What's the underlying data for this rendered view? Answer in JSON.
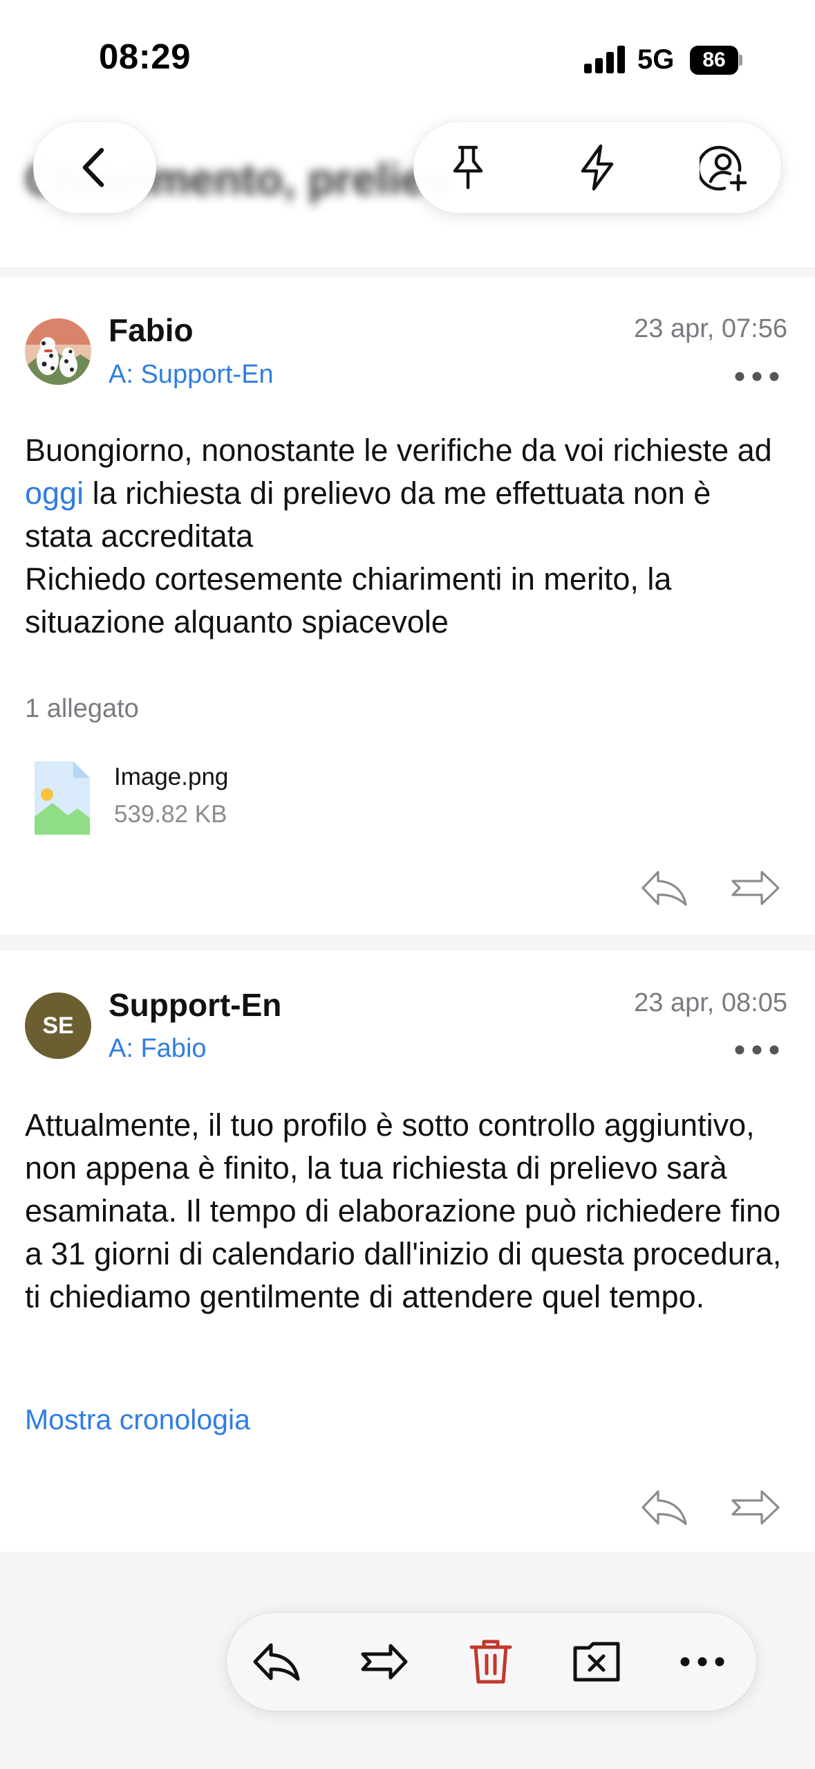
{
  "status_bar": {
    "time": "08:29",
    "network": "5G",
    "battery": "86"
  },
  "header": {
    "title": "Chiarimento, prelievo"
  },
  "messages": [
    {
      "sender": "Fabio",
      "recipient": "A: Support-En",
      "date": "23 apr, 07:56",
      "body_before_link": "Buongiorno, nonostante le verifiche  da voi richieste ad ",
      "body_link": "oggi",
      "body_after_link": " la richiesta di prelievo da me effettuata non è stata accreditata",
      "body_line2": "Richiedo cortesemente chiarimenti in merito, la situazione alquanto spiacevole",
      "attachments_label": "1 allegato",
      "attachment": {
        "name": "Image.png",
        "size": "539.82 KB"
      }
    },
    {
      "sender": "Support-En",
      "avatar_initials": "SE",
      "avatar_color": "#6b5f31",
      "recipient": "A: Fabio",
      "date": "23 apr, 08:05",
      "body": "Attualmente, il tuo profilo è sotto controllo aggiuntivo, non appena è finito, la tua richiesta di prelievo sarà esaminata. Il tempo di elaborazione può richiedere fino a 31 giorni di calendario dall'inizio di questa procedura, ti chiediamo gentilmente di attendere quel tempo.",
      "history_link": "Mostra cronologia"
    }
  ],
  "icons": {
    "back": "chevron-left-icon",
    "pin": "pin-icon",
    "quick": "lightning-icon",
    "add_contact": "add-contact-icon",
    "reply": "reply-icon",
    "forward": "forward-icon",
    "delete": "trash-icon",
    "archive": "archive-x-icon",
    "more": "more-icon"
  },
  "colors": {
    "link": "#2f7de1",
    "delete": "#c0392b",
    "background": "#f4f5f7"
  }
}
